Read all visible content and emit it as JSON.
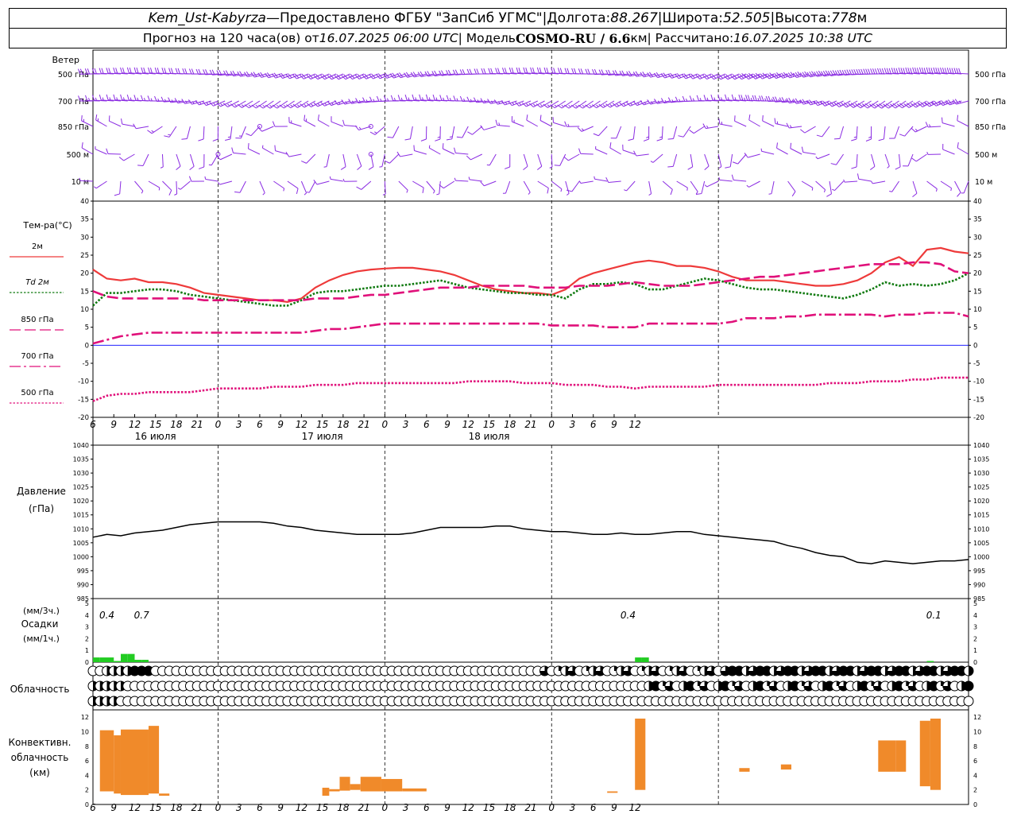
{
  "header": {
    "station": "Kem_Ust-Kabyrza",
    "dash": " — ",
    "provider": "Предоставлено ФГБУ \"ЗапСиб УГМС\"",
    "sep": " | ",
    "lon_label": "Долгота: ",
    "lon_value": "88.267",
    "lat_label": "Широта: ",
    "lat_value": "52.505",
    "alt_label": "Высота: ",
    "alt_value": "778",
    "alt_unit": "м",
    "forecast_label": "Прогноз на 120 часа(ов) от ",
    "forecast_time": "16.07.2025 06:00 UTC",
    "model_label": " | Модель ",
    "model_name": "COSMO-RU / 6.6",
    "model_unit": "км",
    "calc_label": " | Рассчитано: ",
    "calc_time": "16.07.2025 10:38 UTC"
  },
  "colors": {
    "wind": "#8a2be2",
    "t2m": "#ee3a3a",
    "td2m": "#107a10",
    "t850": "#e0107a",
    "t700": "#e0107a",
    "t500": "#e0107a",
    "zero_line": "#0000ff",
    "precip": "#22cc22",
    "convective": "#f08a2a",
    "pressure": "#000000"
  },
  "chart_data": [
    {
      "type": "wind-barbs",
      "title": "Ветер",
      "levels": [
        "500 гПа",
        "700 гПа",
        "850 гПа",
        "500 м",
        "10 м"
      ],
      "time_range_hours": [
        6,
        132
      ],
      "time_step_hours": 1
    },
    {
      "type": "line",
      "title": "Тем-ра(°C)",
      "ylim": [
        -20,
        40
      ],
      "yticks": [
        -20,
        -15,
        -10,
        -5,
        0,
        5,
        10,
        15,
        20,
        25,
        30,
        35,
        40
      ],
      "x_hours": [
        6,
        132
      ],
      "series": [
        {
          "name": "2м",
          "style": "solid",
          "color": "#ee3a3a",
          "x": [
            6,
            8,
            10,
            12,
            14,
            15,
            16,
            18,
            20,
            22,
            24,
            26,
            28,
            30,
            32,
            34,
            36,
            38,
            40,
            42,
            44,
            46,
            48,
            50,
            52,
            54,
            56,
            58,
            60,
            62,
            64,
            66,
            68,
            70,
            72,
            74,
            76,
            78,
            80,
            82,
            84,
            86,
            88,
            90,
            92,
            94,
            96,
            98,
            100,
            102,
            104,
            106,
            108,
            110,
            112,
            114,
            116,
            118,
            120,
            122,
            124,
            126,
            128,
            130,
            132
          ],
          "y": [
            21,
            18.5,
            18,
            18.5,
            17.5,
            17.5,
            17.5,
            17,
            16,
            14.5,
            14,
            13.5,
            13,
            12.5,
            12.5,
            12,
            13,
            16,
            18,
            19.5,
            20.5,
            21,
            21.3,
            21.5,
            21.5,
            21,
            20.5,
            19.5,
            18,
            16.5,
            15.5,
            15,
            14.5,
            14.5,
            14,
            15.5,
            18.5,
            20,
            21,
            22,
            23,
            23.5,
            23,
            22,
            22,
            21.5,
            20.5,
            19,
            18,
            18,
            18,
            17.5,
            17,
            16.5,
            16.5,
            17,
            18,
            20,
            23,
            24.5,
            22,
            26.5,
            27,
            26,
            25.5
          ]
        },
        {
          "name": "Td 2м",
          "style": "dotted",
          "color": "#107a10",
          "x": [
            6,
            8,
            10,
            12,
            14,
            16,
            18,
            20,
            22,
            24,
            26,
            28,
            30,
            32,
            34,
            36,
            38,
            40,
            42,
            44,
            46,
            48,
            50,
            52,
            54,
            56,
            58,
            60,
            62,
            64,
            66,
            68,
            70,
            72,
            74,
            76,
            78,
            80,
            82,
            84,
            86,
            88,
            90,
            92,
            94,
            96,
            98,
            100,
            102,
            104,
            106,
            108,
            110,
            112,
            114,
            116,
            118,
            120,
            122,
            124,
            126,
            128,
            130,
            132
          ],
          "y": [
            11,
            14.5,
            14.5,
            15,
            15.5,
            15.5,
            15,
            14,
            13.5,
            13,
            12.5,
            12,
            11.5,
            11,
            11,
            12.5,
            14.5,
            15,
            15,
            15.5,
            16,
            16.5,
            16.5,
            17,
            17.5,
            18,
            17,
            16,
            15.5,
            15,
            14.5,
            14.5,
            14,
            14,
            13,
            15.5,
            17,
            17,
            17.5,
            17,
            15.5,
            15.5,
            16.5,
            17.5,
            18.5,
            18,
            17,
            16,
            15.5,
            15.5,
            15,
            14.5,
            14,
            13.5,
            13,
            14,
            15.5,
            17.5,
            16.5,
            17,
            16.5,
            17,
            18,
            20
          ]
        },
        {
          "name": "850 гПа",
          "style": "longdash",
          "color": "#e0107a",
          "x": [
            6,
            8,
            10,
            12,
            14,
            16,
            18,
            20,
            22,
            24,
            26,
            28,
            30,
            32,
            34,
            36,
            38,
            40,
            42,
            44,
            46,
            48,
            50,
            52,
            54,
            56,
            58,
            60,
            62,
            64,
            66,
            68,
            70,
            72,
            74,
            76,
            78,
            80,
            82,
            84,
            86,
            88,
            90,
            92,
            94,
            96,
            98,
            100,
            102,
            104,
            106,
            108,
            110,
            112,
            114,
            116,
            118,
            120,
            122,
            124,
            126,
            128,
            130,
            132
          ],
          "y": [
            15,
            13.5,
            13,
            13,
            13,
            13,
            13,
            13,
            12.5,
            12.5,
            12.5,
            12.5,
            12.5,
            12.5,
            12.5,
            12.5,
            13,
            13,
            13,
            13.5,
            14,
            14,
            14.5,
            15,
            15.5,
            16,
            16,
            16,
            16.5,
            16.5,
            16.5,
            16.5,
            16,
            16,
            16,
            16.5,
            16.5,
            16.5,
            17,
            17.5,
            17,
            16.5,
            16.5,
            16.5,
            17,
            17.5,
            18,
            18.5,
            19,
            19,
            19.5,
            20,
            20.5,
            21,
            21.5,
            22,
            22.5,
            22.5,
            22.5,
            23,
            23,
            22.5,
            20.5,
            20
          ]
        },
        {
          "name": "700 гПа",
          "style": "dashdot",
          "color": "#e0107a",
          "x": [
            6,
            8,
            10,
            12,
            14,
            16,
            18,
            20,
            22,
            24,
            26,
            28,
            30,
            32,
            34,
            36,
            38,
            40,
            42,
            44,
            46,
            48,
            50,
            52,
            54,
            56,
            58,
            60,
            62,
            64,
            66,
            68,
            70,
            72,
            74,
            76,
            78,
            80,
            82,
            84,
            86,
            88,
            90,
            92,
            94,
            96,
            98,
            100,
            102,
            104,
            106,
            108,
            110,
            112,
            114,
            116,
            118,
            120,
            122,
            124,
            126,
            128,
            130,
            132
          ],
          "y": [
            0.5,
            1.5,
            2.5,
            3,
            3.5,
            3.5,
            3.5,
            3.5,
            3.5,
            3.5,
            3.5,
            3.5,
            3.5,
            3.5,
            3.5,
            3.5,
            4,
            4.5,
            4.5,
            5,
            5.5,
            6,
            6,
            6,
            6,
            6,
            6,
            6,
            6,
            6,
            6,
            6,
            6,
            5.5,
            5.5,
            5.5,
            5.5,
            5,
            5,
            5,
            6,
            6,
            6,
            6,
            6,
            6,
            6.5,
            7.5,
            7.5,
            7.5,
            8,
            8,
            8.5,
            8.5,
            8.5,
            8.5,
            8.5,
            8,
            8.5,
            8.5,
            9,
            9,
            9,
            8
          ]
        },
        {
          "name": "500 гПа",
          "style": "dotted",
          "color": "#e0107a",
          "x": [
            6,
            8,
            10,
            12,
            14,
            16,
            18,
            20,
            22,
            24,
            26,
            28,
            30,
            32,
            34,
            36,
            38,
            40,
            42,
            44,
            46,
            48,
            50,
            52,
            54,
            56,
            58,
            60,
            62,
            64,
            66,
            68,
            70,
            72,
            74,
            76,
            78,
            80,
            82,
            84,
            86,
            88,
            90,
            92,
            94,
            96,
            98,
            100,
            102,
            104,
            106,
            108,
            110,
            112,
            114,
            116,
            118,
            120,
            122,
            124,
            126,
            128,
            130,
            132
          ],
          "y": [
            -15.5,
            -14,
            -13.5,
            -13.5,
            -13,
            -13,
            -13,
            -13,
            -12.5,
            -12,
            -12,
            -12,
            -12,
            -11.5,
            -11.5,
            -11.5,
            -11,
            -11,
            -11,
            -10.5,
            -10.5,
            -10.5,
            -10.5,
            -10.5,
            -10.5,
            -10.5,
            -10.5,
            -10,
            -10,
            -10,
            -10,
            -10.5,
            -10.5,
            -10.5,
            -11,
            -11,
            -11,
            -11.5,
            -11.5,
            -12,
            -11.5,
            -11.5,
            -11.5,
            -11.5,
            -11.5,
            -11,
            -11,
            -11,
            -11,
            -11,
            -11,
            -11,
            -11,
            -10.5,
            -10.5,
            -10.5,
            -10,
            -10,
            -10,
            -9.5,
            -9.5,
            -9,
            -9,
            -9
          ]
        }
      ],
      "xticks": [
        6,
        9,
        12,
        15,
        18,
        21,
        0,
        3,
        6,
        9,
        12,
        15,
        18,
        21,
        0,
        3,
        6,
        9,
        12,
        15,
        18,
        21,
        0,
        3,
        6,
        9,
        12
      ],
      "day_labels": [
        "16 июля",
        "17 июля",
        "18 июля"
      ]
    },
    {
      "type": "line",
      "title": "Давление",
      "unit": "(гПа)",
      "ylim": [
        985,
        1040
      ],
      "yticks": [
        985,
        990,
        995,
        1000,
        1005,
        1010,
        1015,
        1020,
        1025,
        1030,
        1035,
        1040
      ],
      "x": [
        6,
        8,
        10,
        12,
        14,
        16,
        18,
        20,
        22,
        24,
        26,
        28,
        30,
        32,
        34,
        36,
        38,
        40,
        42,
        44,
        46,
        48,
        50,
        52,
        54,
        56,
        58,
        60,
        62,
        64,
        66,
        68,
        70,
        72,
        74,
        76,
        78,
        80,
        82,
        84,
        86,
        88,
        90,
        92,
        94,
        96,
        98,
        100,
        102,
        104,
        106,
        108,
        110,
        112,
        114,
        116,
        118,
        120,
        122,
        124,
        126,
        128,
        130,
        132
      ],
      "y": [
        1007,
        1008,
        1007.5,
        1008.5,
        1009,
        1009.5,
        1010.5,
        1011.5,
        1012,
        1012.5,
        1012.5,
        1012.5,
        1012.5,
        1012,
        1011,
        1010.5,
        1009.5,
        1009,
        1008.5,
        1008,
        1008,
        1008,
        1008,
        1008.5,
        1009.5,
        1010.5,
        1010.5,
        1010.5,
        1010.5,
        1011,
        1011,
        1010,
        1009.5,
        1009,
        1009,
        1008.5,
        1008,
        1008,
        1008.5,
        1008,
        1008,
        1008.5,
        1009,
        1009,
        1008,
        1007.5,
        1007,
        1006.5,
        1006,
        1005.5,
        1004,
        1003,
        1001.5,
        1000.5,
        1000,
        998,
        997.5,
        998.5,
        998,
        997.5,
        998,
        998.5,
        998.5,
        999
      ]
    },
    {
      "type": "bar",
      "title": "Осадки",
      "unit_left_top": "(мм/3ч.)",
      "unit_left_bottom": "(мм/1ч.)",
      "ylim": [
        0,
        5
      ],
      "yticks": [
        0,
        1,
        2,
        3,
        4,
        5
      ],
      "x": [
        6,
        7,
        8,
        9,
        10,
        11,
        12,
        13,
        84,
        85,
        126
      ],
      "values": [
        0.4,
        0.4,
        0.4,
        0.1,
        0.7,
        0.7,
        0.2,
        0.2,
        0.4,
        0.4,
        0.1
      ],
      "labels": [
        {
          "x": 8,
          "text": "0.4"
        },
        {
          "x": 13,
          "text": "0.7"
        },
        {
          "x": 83,
          "text": "0.4"
        },
        {
          "x": 127,
          "text": "0.1"
        }
      ]
    },
    {
      "type": "table",
      "title": "Облачность",
      "rows": 3,
      "x_hours": [
        6,
        132
      ]
    },
    {
      "type": "bar",
      "title": "Конвективн.",
      "title2": "облачность",
      "unit": "(км)",
      "ylim": [
        0,
        13
      ],
      "yticks": [
        0,
        2,
        4,
        6,
        8,
        10,
        12
      ],
      "cells": [
        {
          "x0": 7,
          "x1": 9,
          "bottom": 1.8,
          "top": 10.2
        },
        {
          "x0": 9,
          "x1": 10,
          "bottom": 1.5,
          "top": 9.5
        },
        {
          "x0": 10,
          "x1": 14,
          "bottom": 1.3,
          "top": 10.3
        },
        {
          "x0": 14,
          "x1": 15.5,
          "bottom": 1.5,
          "top": 10.8
        },
        {
          "x0": 15.5,
          "x1": 17,
          "bottom": 1.2,
          "top": 1.5
        },
        {
          "x0": 39,
          "x1": 40,
          "bottom": 1.2,
          "top": 2.3
        },
        {
          "x0": 40,
          "x1": 41.5,
          "bottom": 1.8,
          "top": 2.1
        },
        {
          "x0": 41.5,
          "x1": 43,
          "bottom": 1.9,
          "top": 3.8
        },
        {
          "x0": 43,
          "x1": 44.5,
          "bottom": 2,
          "top": 2.8
        },
        {
          "x0": 44.5,
          "x1": 47.5,
          "bottom": 1.8,
          "top": 3.8
        },
        {
          "x0": 47.5,
          "x1": 50.5,
          "bottom": 1.8,
          "top": 3.5
        },
        {
          "x0": 50.5,
          "x1": 54,
          "bottom": 1.8,
          "top": 2.2
        },
        {
          "x0": 80,
          "x1": 81.5,
          "bottom": 1.6,
          "top": 1.8
        },
        {
          "x0": 84,
          "x1": 85.5,
          "bottom": 2,
          "top": 11.8
        },
        {
          "x0": 99,
          "x1": 100.5,
          "bottom": 4.5,
          "top": 5
        },
        {
          "x0": 105,
          "x1": 106.5,
          "bottom": 4.8,
          "top": 5.5
        },
        {
          "x0": 119,
          "x1": 121.5,
          "bottom": 4.5,
          "top": 8.8
        },
        {
          "x0": 121.5,
          "x1": 123,
          "bottom": 4.5,
          "top": 8.8
        },
        {
          "x0": 125,
          "x1": 126.5,
          "bottom": 2.5,
          "top": 11.5
        },
        {
          "x0": 126.5,
          "x1": 128,
          "bottom": 2,
          "top": 11.8
        }
      ]
    }
  ],
  "xaxis_labels": [
    "6",
    "9",
    "12",
    "15",
    "18",
    "21",
    "0",
    "3",
    "6",
    "9",
    "12",
    "15",
    "18",
    "21",
    "0",
    "3",
    "6",
    "9",
    "12",
    "15",
    "18",
    "21",
    "0",
    "3",
    "6",
    "9",
    "12"
  ]
}
